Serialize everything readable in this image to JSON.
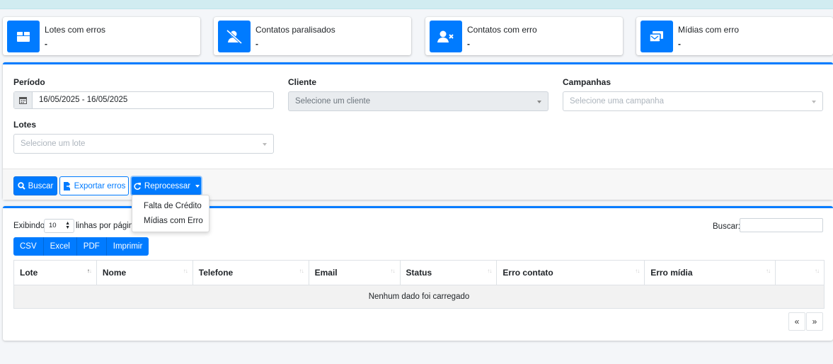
{
  "stats": [
    {
      "title": "Lotes com erros",
      "value": "-",
      "icon": "box-icon"
    },
    {
      "title": "Contatos paralisados",
      "value": "-",
      "icon": "user-slash-icon"
    },
    {
      "title": "Contatos com erro",
      "value": "-",
      "icon": "user-x-icon"
    },
    {
      "title": "Mídias com erro",
      "value": "-",
      "icon": "media-x-icon"
    }
  ],
  "filters": {
    "periodo_label": "Período",
    "periodo_value": "16/05/2025 - 16/05/2025",
    "cliente_label": "Cliente",
    "cliente_placeholder": "Selecione um cliente",
    "campanhas_label": "Campanhas",
    "campanhas_placeholder": "Selecione uma campanha",
    "lotes_label": "Lotes",
    "lotes_placeholder": "Selecione um lote"
  },
  "actions": {
    "buscar": "Buscar",
    "exportar": "Exportar erros",
    "reprocessar": "Reprocessar"
  },
  "dropdown": {
    "items": [
      "Falta de Crédito",
      "Mídias com Erro"
    ]
  },
  "table": {
    "length_prefix": "Exibindo",
    "length_value": "10",
    "length_suffix": "linhas por página",
    "search_label": "Buscar:",
    "export_buttons": [
      "CSV",
      "Excel",
      "PDF",
      "Imprimir"
    ],
    "columns": [
      "Lote",
      "Nome",
      "Telefone",
      "Email",
      "Status",
      "Erro contato",
      "Erro mídia",
      ""
    ],
    "empty_message": "Nenhum dado foi carregado",
    "pager_prev": "«",
    "pager_next": "»"
  },
  "colors": {
    "primary": "#007bff",
    "topbar": "#d1ecf1"
  }
}
